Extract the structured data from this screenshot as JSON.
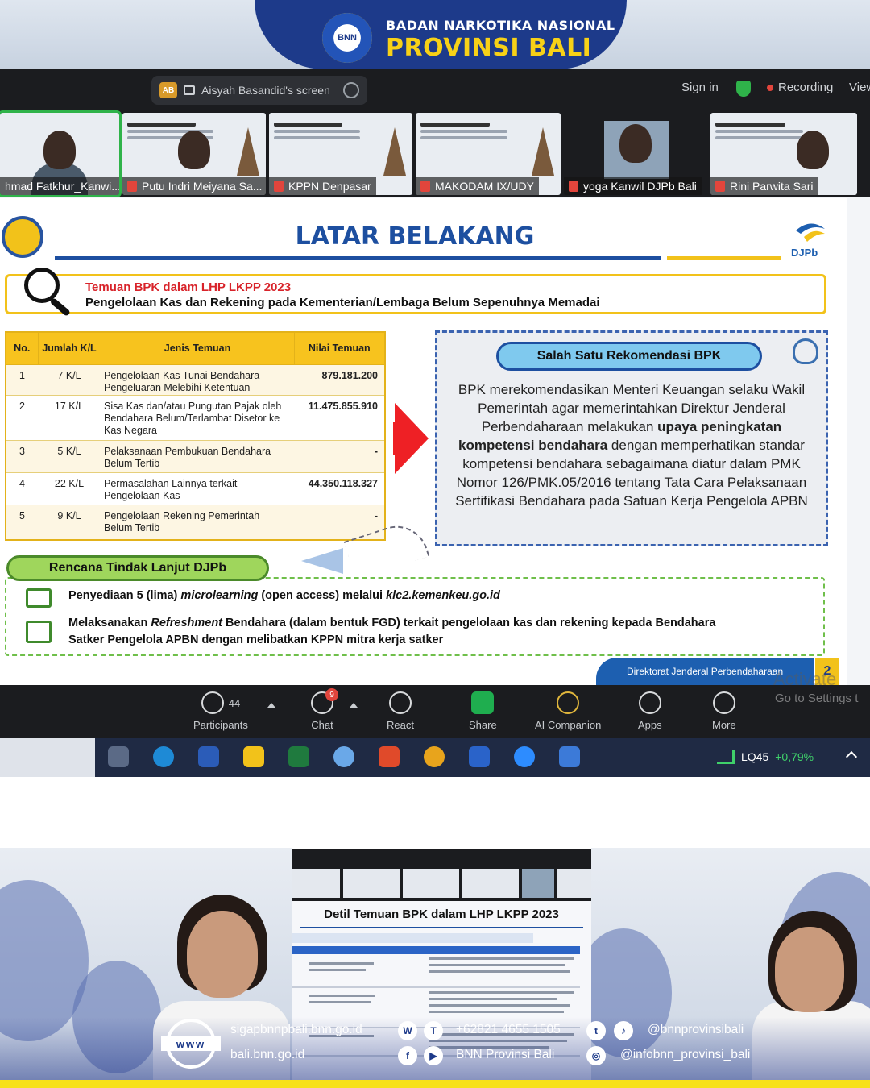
{
  "header": {
    "org_small": "BADAN NARKOTIKA NASIONAL",
    "org_big": "PROVINSI BALI",
    "logo_text": "BNN"
  },
  "zoom_top": {
    "share_badge": "AB",
    "share_label": "Aisyah Basandid's screen",
    "sign_in": "Sign in",
    "recording": "Recording",
    "view": "View"
  },
  "participants": [
    {
      "name": "hmad Fatkhur_Kanwi..."
    },
    {
      "name": "Putu Indri Meiyana Sa..."
    },
    {
      "name": "KPPN Denpasar"
    },
    {
      "name": "MAKODAM IX/UDY"
    },
    {
      "name": "yoga Kanwil DJPb Bali"
    },
    {
      "name": "Rini Parwita Sari"
    }
  ],
  "slide": {
    "title": "LATAR BELAKANG",
    "brand": "DJPb",
    "temuan_red": "Temuan BPK dalam LHP LKPP 2023",
    "temuan_black": "Pengelolaan Kas dan Rekening pada Kementerian/Lembaga Belum Sepenuhnya Memadai",
    "table": {
      "headers": {
        "no": "No.",
        "jumlah": "Jumlah K/L",
        "jenis": "Jenis Temuan",
        "nilai": "Nilai Temuan"
      },
      "rows": [
        {
          "no": "1",
          "kl": "7 K/L",
          "jenis": "Pengelolaan Kas Tunai Bendahara Pengeluaran Melebihi Ketentuan",
          "nilai": "879.181.200"
        },
        {
          "no": "2",
          "kl": "17 K/L",
          "jenis": "Sisa Kas dan/atau Pungutan Pajak oleh Bendahara Belum/Terlambat Disetor ke Kas Negara",
          "nilai": "11.475.855.910"
        },
        {
          "no": "3",
          "kl": "5 K/L",
          "jenis": "Pelaksanaan Pembukuan Bendahara Belum Tertib",
          "nilai": "-"
        },
        {
          "no": "4",
          "kl": "22 K/L",
          "jenis": "Permasalahan Lainnya terkait Pengelolaan Kas",
          "nilai": "44.350.118.327"
        },
        {
          "no": "5",
          "kl": "9 K/L",
          "jenis": "Pengelolaan Rekening Pemerintah Belum Tertib",
          "nilai": "-"
        }
      ]
    },
    "rekomendasi": {
      "title": "Salah Satu Rekomendasi BPK",
      "text_1": "BPK merekomendasikan Menteri Keuangan selaku Wakil Pemerintah agar memerintahkan Direktur Jenderal Perbendaharaan melakukan ",
      "text_bold": "upaya peningkatan kompetensi bendahara",
      "text_2": " dengan memperhatikan standar kompetensi bendahara sebagaimana diatur dalam PMK Nomor 126/PMK.05/2016 tentang Tata Cara Pelaksanaan Sertifikasi Bendahara pada Satuan Kerja Pengelola APBN"
    },
    "rtl": {
      "title": "Rencana Tindak Lanjut DJPb",
      "item1_a": "Penyediaan 5 (lima) ",
      "item1_b": "microlearning",
      "item1_c": " (open access) melalui ",
      "item1_d": "klc2.kemenkeu.go.id",
      "item2_a": "Melaksanakan ",
      "item2_b": "Refreshment",
      "item2_c": " Bendahara (dalam bentuk FGD) terkait pengelolaan kas dan rekening kepada Bendahara",
      "item2_d": "Satker Pengelola APBN dengan melibatkan KPPN mitra kerja satker"
    },
    "footer": "Direktorat Jenderal Perbendaharaan",
    "page_number": "2",
    "activate": "Activate Windows"
  },
  "toolbar": {
    "participants_count": "44",
    "participants": "Participants",
    "chat": "Chat",
    "chat_badge": "9",
    "react": "React",
    "share": "Share",
    "ai": "AI Companion",
    "apps": "Apps",
    "more": "More",
    "goto": "Go to Settings t"
  },
  "taskbar": {
    "ticker": "LQ45",
    "change": "+0,79%"
  },
  "mini_slide": {
    "title": "Detil Temuan BPK dalam LHP LKPP 2023"
  },
  "contact": {
    "www": "www",
    "website1": "sigapbnnpbali.bnn.go.id",
    "website2": "bali.bnn.go.id",
    "phone": "+62821 4655 1505",
    "facebook": "BNN Provinsi Bali",
    "twitter": "@bnnprovinsibali",
    "instagram": "@infobnn_provinsi_bali"
  },
  "colors": {
    "brand_blue": "#1d3a8a",
    "brand_yellow": "#f7d117",
    "table_yellow": "#f7c31e",
    "rtl_green": "#9fd65c",
    "rek_blue": "#7fc9ee"
  }
}
